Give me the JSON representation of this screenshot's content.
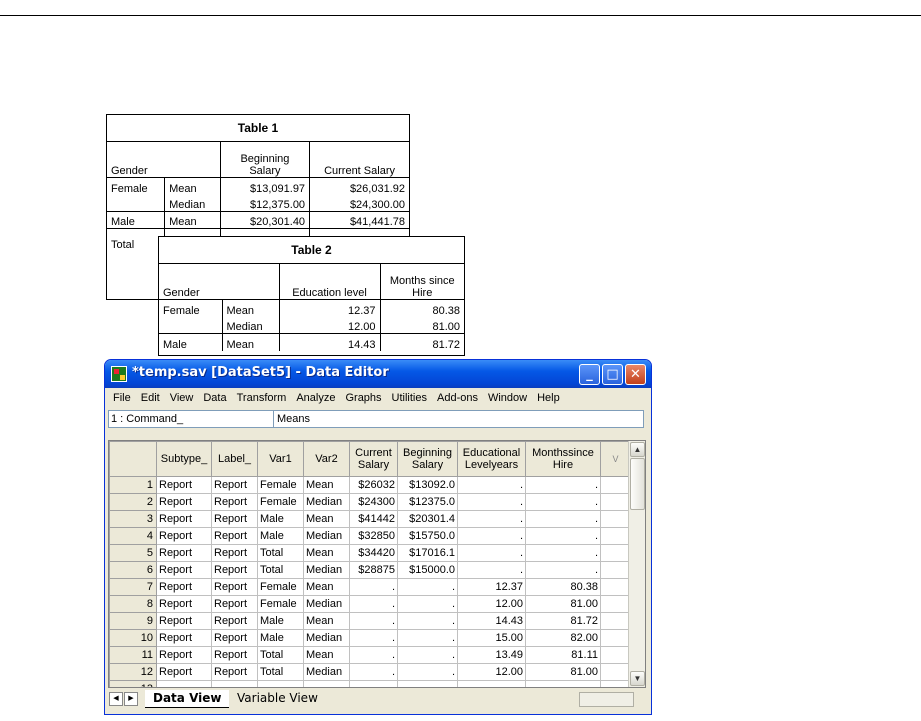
{
  "table1": {
    "title": "Table 1",
    "headers": [
      "Gender",
      "Beginning Salary",
      "Current Salary"
    ],
    "rows": [
      [
        "Female",
        "Mean",
        "$13,091.97",
        "$26,031.92"
      ],
      [
        "",
        "Median",
        "$12,375.00",
        "$24,300.00"
      ],
      [
        "Male",
        "Mean",
        "$20,301.40",
        "$41,441.78"
      ],
      [
        "Total",
        "",
        "",
        ""
      ]
    ]
  },
  "table2": {
    "title": "Table 2",
    "headers": [
      "Gender",
      "Education level",
      "Months since Hire"
    ],
    "rows": [
      [
        "Female",
        "Mean",
        "12.37",
        "80.38"
      ],
      [
        "",
        "Median",
        "12.00",
        "81.00"
      ],
      [
        "Male",
        "Mean",
        "14.43",
        "81.72"
      ]
    ]
  },
  "window": {
    "title": "*temp.sav [DataSet5] - Data Editor",
    "menu": [
      "File",
      "Edit",
      "View",
      "Data",
      "Transform",
      "Analyze",
      "Graphs",
      "Utilities",
      "Add-ons",
      "Window",
      "Help"
    ],
    "cell_ref": "1 : Command_",
    "cell_value": "Means",
    "columns": [
      "Subtype_",
      "Label_",
      "Var1",
      "Var2",
      "Current Salary",
      "Beginning Salary",
      "Educational Levelyears",
      "Monthssince Hire",
      "V"
    ],
    "rows": [
      [
        "1",
        "Report",
        "Report",
        "Female",
        "Mean",
        "$26032",
        "$13092.0",
        ".",
        "."
      ],
      [
        "2",
        "Report",
        "Report",
        "Female",
        "Median",
        "$24300",
        "$12375.0",
        ".",
        "."
      ],
      [
        "3",
        "Report",
        "Report",
        "Male",
        "Mean",
        "$41442",
        "$20301.4",
        ".",
        "."
      ],
      [
        "4",
        "Report",
        "Report",
        "Male",
        "Median",
        "$32850",
        "$15750.0",
        ".",
        "."
      ],
      [
        "5",
        "Report",
        "Report",
        "Total",
        "Mean",
        "$34420",
        "$17016.1",
        ".",
        "."
      ],
      [
        "6",
        "Report",
        "Report",
        "Total",
        "Median",
        "$28875",
        "$15000.0",
        ".",
        "."
      ],
      [
        "7",
        "Report",
        "Report",
        "Female",
        "Mean",
        ".",
        ".",
        "12.37",
        "80.38"
      ],
      [
        "8",
        "Report",
        "Report",
        "Female",
        "Median",
        ".",
        ".",
        "12.00",
        "81.00"
      ],
      [
        "9",
        "Report",
        "Report",
        "Male",
        "Mean",
        ".",
        ".",
        "14.43",
        "81.72"
      ],
      [
        "10",
        "Report",
        "Report",
        "Male",
        "Median",
        ".",
        ".",
        "15.00",
        "82.00"
      ],
      [
        "11",
        "Report",
        "Report",
        "Total",
        "Mean",
        ".",
        ".",
        "13.49",
        "81.11"
      ],
      [
        "12",
        "Report",
        "Report",
        "Total",
        "Median",
        ".",
        ".",
        "12.00",
        "81.00"
      ],
      [
        "13",
        "",
        "",
        "",
        "",
        "",
        "",
        "",
        ""
      ]
    ],
    "tabs": [
      "Data View",
      "Variable View"
    ]
  },
  "icons": {
    "app": "spss-data-editor-icon",
    "minimize": "minimize-icon",
    "maximize": "maximize-icon",
    "close": "close-icon"
  },
  "colors": {
    "titlebar": "#0558E6",
    "chrome": "#ECE9D8",
    "close_button": "#c2401a"
  }
}
